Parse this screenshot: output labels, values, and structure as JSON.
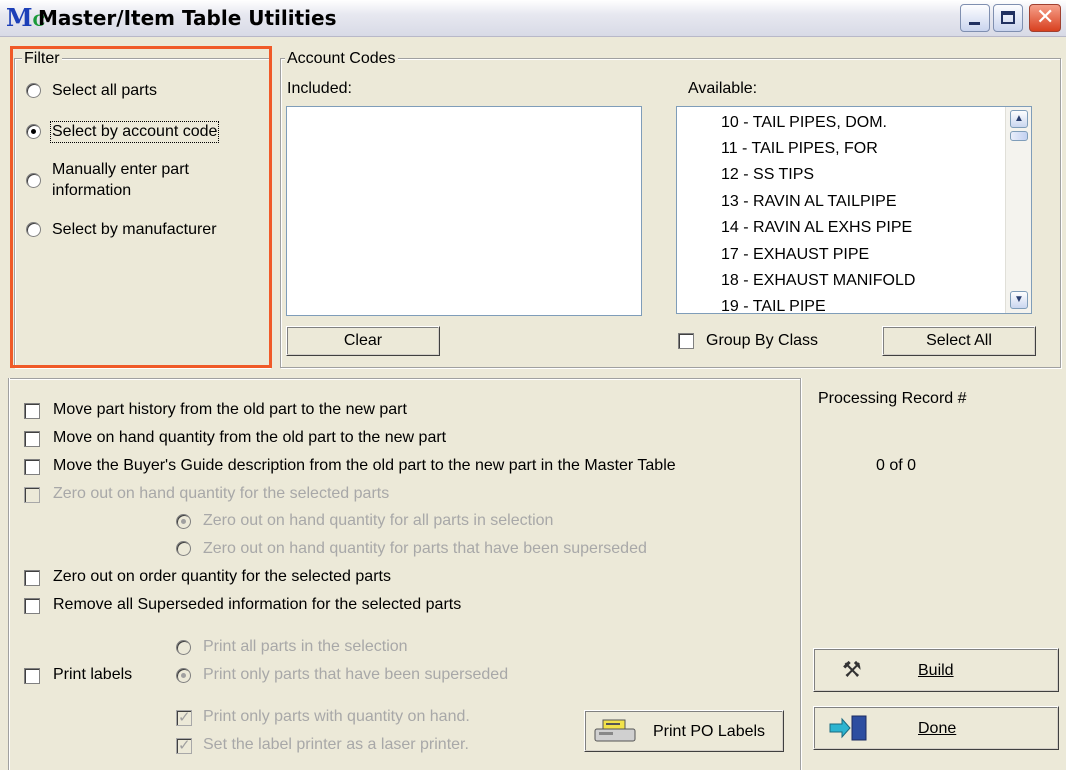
{
  "window": {
    "title": "Master/Item Table Utilities",
    "icon": "mc-logo-icon",
    "controls": [
      "minimize-icon",
      "maximize-icon",
      "close-icon"
    ]
  },
  "filter": {
    "legend": "Filter",
    "options": [
      {
        "label": "Select all parts",
        "selected": false
      },
      {
        "label": "Select by account code",
        "selected": true
      },
      {
        "label_line1": "Manually enter part",
        "label_line2": "information",
        "selected": false
      },
      {
        "label": "Select by manufacturer",
        "selected": false
      }
    ],
    "highlight_color": "#f05a28"
  },
  "account_codes": {
    "legend": "Account Codes",
    "included_label": "Included:",
    "available_label": "Available:",
    "available_items": [
      "10 - TAIL PIPES, DOM.",
      "11 - TAIL PIPES, FOR",
      "12 - SS TIPS",
      "13 - RAVIN AL TAILPIPE",
      "14 - RAVIN AL EXHS PIPE",
      "17 - EXHAUST PIPE",
      "18 - EXHAUST MANIFOLD",
      "19 - TAIL PIPE"
    ],
    "clear_label": "Clear",
    "group_by_class_label": "Group By Class",
    "group_by_class_checked": false,
    "select_all_label": "Select All"
  },
  "options": {
    "move_history": "Move part history from the old part to the new part",
    "move_on_hand": "Move on hand quantity from the old part to the new part",
    "move_buyers_guide": "Move the Buyer's Guide description from the old part to the new part in the Master Table",
    "zero_on_hand": "Zero out on hand quantity for the selected parts",
    "zero_all_parts": "Zero out on hand quantity for all parts in selection",
    "zero_superseded": "Zero out on hand quantity for parts that have been superseded",
    "zero_on_order": "Zero out on order quantity for the selected parts",
    "remove_superseded": "Remove all Superseded information for the selected parts",
    "print_labels": "Print labels",
    "print_all": "Print all parts in the selection",
    "print_superseded": "Print only parts that have been superseded",
    "print_with_qty": "Print only parts with quantity on hand.",
    "laser_printer": "Set the label printer as a laser printer.",
    "print_po_labels": "Print PO Labels"
  },
  "processing": {
    "heading": "Processing Record #",
    "status": "0  of 0"
  },
  "actions": {
    "build_label": "Build",
    "done_label": "Done"
  }
}
